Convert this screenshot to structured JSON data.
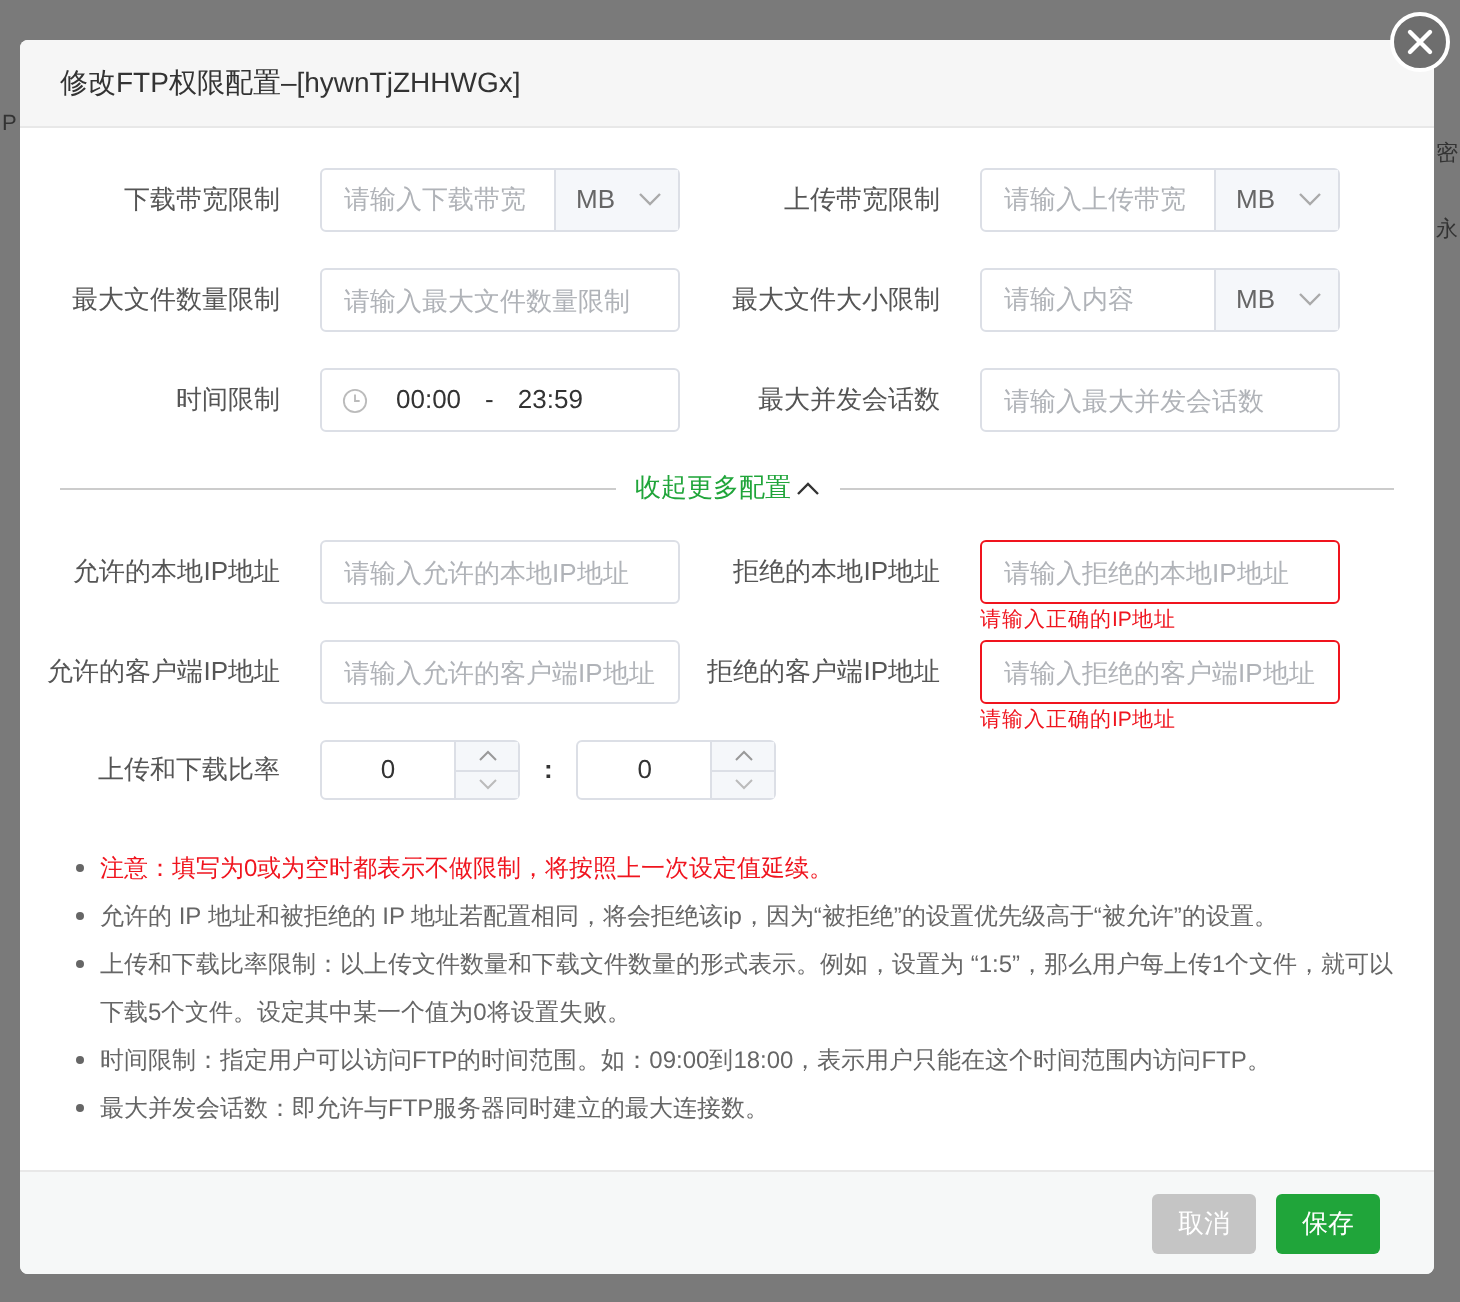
{
  "background": {
    "texts": [
      "P",
      "密",
      "永"
    ]
  },
  "dialog": {
    "title": "修改FTP权限配置–[hywnTjZHHWGx]",
    "fields": [
      {
        "kind": "unit-input",
        "label": "下载带宽限制",
        "placeholder": "请输入下载带宽",
        "unit": "MB",
        "invalid": false
      },
      {
        "kind": "unit-input",
        "label": "上传带宽限制",
        "placeholder": "请输入上传带宽",
        "unit": "MB",
        "invalid": false
      },
      {
        "kind": "input",
        "label": "最大文件数量限制",
        "placeholder": "请输入最大文件数量限制",
        "invalid": false
      },
      {
        "kind": "unit-input",
        "label": "最大文件大小限制",
        "placeholder": "请输入内容",
        "unit": "MB",
        "invalid": false
      },
      {
        "kind": "time-range",
        "label": "时间限制",
        "start": "00:00",
        "separator": "-",
        "end": "23:59",
        "invalid": false
      },
      {
        "kind": "input",
        "label": "最大并发会话数",
        "placeholder": "请输入最大并发会话数",
        "invalid": false
      }
    ],
    "toggle": {
      "label": "收起更多配置",
      "expanded": true
    },
    "more_fields": [
      {
        "kind": "input",
        "label": "允许的本地IP地址",
        "placeholder": "请输入允许的本地IP地址",
        "invalid": false
      },
      {
        "kind": "input",
        "label": "拒绝的本地IP地址",
        "placeholder": "请输入拒绝的本地IP地址",
        "invalid": true,
        "error": "请输入正确的IP地址"
      },
      {
        "kind": "input",
        "label": "允许的客户端IP地址",
        "placeholder": "请输入允许的客户端IP地址",
        "invalid": false
      },
      {
        "kind": "input",
        "label": "拒绝的客户端IP地址",
        "placeholder": "请输入拒绝的客户端IP地址",
        "invalid": true,
        "error": "请输入正确的IP地址"
      }
    ],
    "ratio": {
      "label": "上传和下载比率",
      "upload": "0",
      "separator": ":",
      "download": "0"
    },
    "notes": [
      {
        "text": "注意：填写为0或为空时都表示不做限制，将按照上一次设定值延续。",
        "warning": true
      },
      {
        "text": "允许的 IP 地址和被拒绝的 IP 地址若配置相同，将会拒绝该ip，因为“被拒绝”的设置优先级高于“被允许”的设置。",
        "warning": false
      },
      {
        "text": "上传和下载比率限制：以上传文件数量和下载文件数量的形式表示。例如，设置为 “1:5”，那么用户每上传1个文件，就可以下载5个文件。设定其中某一个值为0将设置失败。",
        "warning": false
      },
      {
        "text": "时间限制：指定用户可以访问FTP的时间范围。如：09:00到18:00，表示用户只能在这个时间范围内访问FTP。",
        "warning": false
      },
      {
        "text": "最大并发会话数：即允许与FTP服务器同时建立的最大连接数。",
        "warning": false
      }
    ],
    "buttons": [
      {
        "kind": "cancel",
        "label": "取消"
      },
      {
        "kind": "primary",
        "label": "保存"
      }
    ]
  }
}
